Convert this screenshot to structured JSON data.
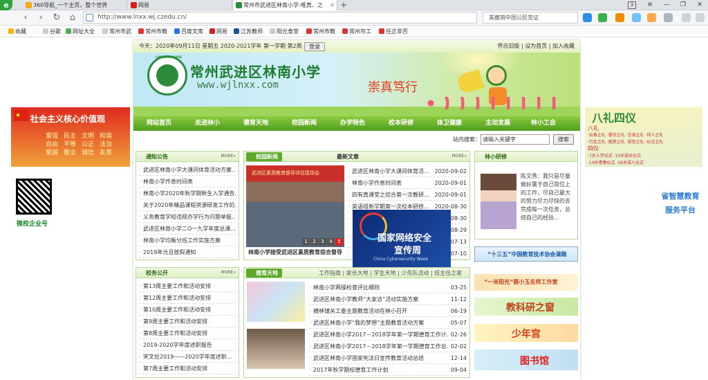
{
  "browser": {
    "tabs": [
      {
        "title": "360导航_一个主页，整个世界",
        "active": false
      },
      {
        "title": "网易",
        "active": false
      },
      {
        "title": "常州市武进区林南小学-唯真、之",
        "active": true
      }
    ],
    "new_tab": "+",
    "tab_count": "3",
    "url": "http://www.lnxx.wj.czedu.cn/",
    "search_text": "美撤销中国公民签证",
    "bookmarks": [
      "收藏",
      "谷歌",
      "网址大全",
      "常州市武",
      "常州市教",
      "百度文库",
      "网易",
      "江苏教师",
      "阳光食堂",
      "常州市教",
      "常州市工",
      "任正非否"
    ]
  },
  "site": {
    "date_line": "今天：2020年09月11日 星期五 2020-2021学年 第一学期 第2周",
    "login": "登录",
    "top_links": "怀念旧版 | 设为首页 | 加入收藏",
    "title": "常州武进区林南小学",
    "url_text": "www.wjlnxx.com",
    "motto": "崇真笃行",
    "logo_text": "LINNAN XIAOXUE",
    "nav": [
      "网站首页",
      "走进林小",
      "德育天地",
      "校园新闻",
      "办学特色",
      "校本研修",
      "体卫健康",
      "主动发展",
      "林小工会"
    ],
    "search_label": "站内搜索：",
    "search_placeholder": "请输入关键字",
    "search_btn": "搜索"
  },
  "more": "MORE»",
  "notices": {
    "title": "通知公告",
    "items": [
      "武进区林南小学大课间体育活动方案...",
      "林南小学作息时间表",
      "林南小学2020年秋学期新生入学通告...",
      "关于2020年精品课程资源研发工作的...",
      "义务教育学校违规办学行为问题举报...",
      "武进区林南小学二O一九学年度总课...",
      "林南小学均衡分班工作实施方案",
      "2019年元旦放假通知"
    ]
  },
  "campus_news": {
    "title": "校园新闻",
    "banner": "武进区素质教育督导评估现场会",
    "caption": "林南小学接受武进区素质教育综合督导",
    "pager": [
      "1",
      "2",
      "3",
      "4",
      "5"
    ],
    "latest_title": "最新文章",
    "items": [
      {
        "t": "武进区林南小学大课间体育活...",
        "d": "2020-09-02"
      },
      {
        "t": "林南小学作息时间表",
        "d": "2020-09-01"
      },
      {
        "t": "四有真课堂之综合第一次教研...",
        "d": "2020-09-01"
      },
      {
        "t": "英语组新学期第一次校本研修...",
        "d": "2020-08-30"
      },
      {
        "t": "",
        "d": "08-30"
      },
      {
        "t": "",
        "d": "08-29"
      },
      {
        "t": "",
        "d": "07-13"
      },
      {
        "t": "",
        "d": "07-10"
      }
    ]
  },
  "cyber_ad": {
    "line1": "国家网络安全",
    "line2": "宣传周",
    "en": "China Cybersecurity Week"
  },
  "teacher": {
    "title": "林小研修",
    "text": "陈文秀：我只是尽量做好属于自己岗位上的工作，尽自己最大的努力尽力尽快的去完成每一次任务，总结自己的经验..."
  },
  "school_affairs": {
    "title": "校务公开",
    "items": [
      "第13周主要工作和活动安排",
      "第12周主要工作和活动安排",
      "第10周主要工作和活动安排",
      "第9周主要工作和活动安排",
      "第8周主要工作和活动安排",
      "2019-2020学年度述职报告",
      "宋文俭2019——2020学年度述职...",
      "第7周主要工作和活动安排"
    ]
  },
  "moral": {
    "title": "德育天地",
    "tabs1": "工作指南 | 家长大地 | 学生天地 | 少先队活动 | 班主任之家",
    "items": [
      {
        "t": "林南小学两操检查评比细则",
        "d": "03-25"
      },
      {
        "t": "武进区林南小学教师“大家访”活动实施方案",
        "d": "11-12"
      },
      {
        "t": "横林镇关工委主题教育活动在林小召开",
        "d": "06-19"
      },
      {
        "t": "武进区林南小学“我的梦想”主题教育活动方案",
        "d": "05-07"
      },
      {
        "t": "武进区林南小学2017－2018学年第一学期德育工作计...",
        "d": "02-26"
      },
      {
        "t": "武进区林南小学2017－2018学年第一学期德育工作总...",
        "d": "02-02"
      },
      {
        "t": "武进区林南小学国家宪法日宣传教育活动总结",
        "d": "12-14"
      },
      {
        "t": "2017年秋学期校德育工作计划",
        "d": "09-04"
      }
    ]
  },
  "ads": {
    "left_values": "社会主义核心价值观",
    "left_words": [
      "富强",
      "民主",
      "文明",
      "和谐",
      "自由",
      "平等",
      "公正",
      "法治",
      "爱国",
      "敬业",
      "诚信",
      "友善"
    ],
    "qr_label": "微校企业号",
    "right_title": "八礼四仪",
    "right_sub": "八礼",
    "right_sub2": "四仪",
    "right_lines": [
      "·仪表之礼 ·餐饮之礼 ·言谈之礼 ·待人之礼",
      "·行走之礼 ·观赏之礼 ·游览之礼 ·仪式之礼",
      "·7岁入学仪式 ·10岁成长仪式",
      "·14岁青春仪式 ·18岁成人仪式"
    ],
    "smart_edu": "省智慧教育服务平台",
    "thirteen": "“十三五”中国教育技术协会课题",
    "sunshine": "“一米阳光”蔡小玉名师工作室",
    "research": "教科研之窗",
    "youth": "少年宫",
    "library": "图书馆"
  }
}
